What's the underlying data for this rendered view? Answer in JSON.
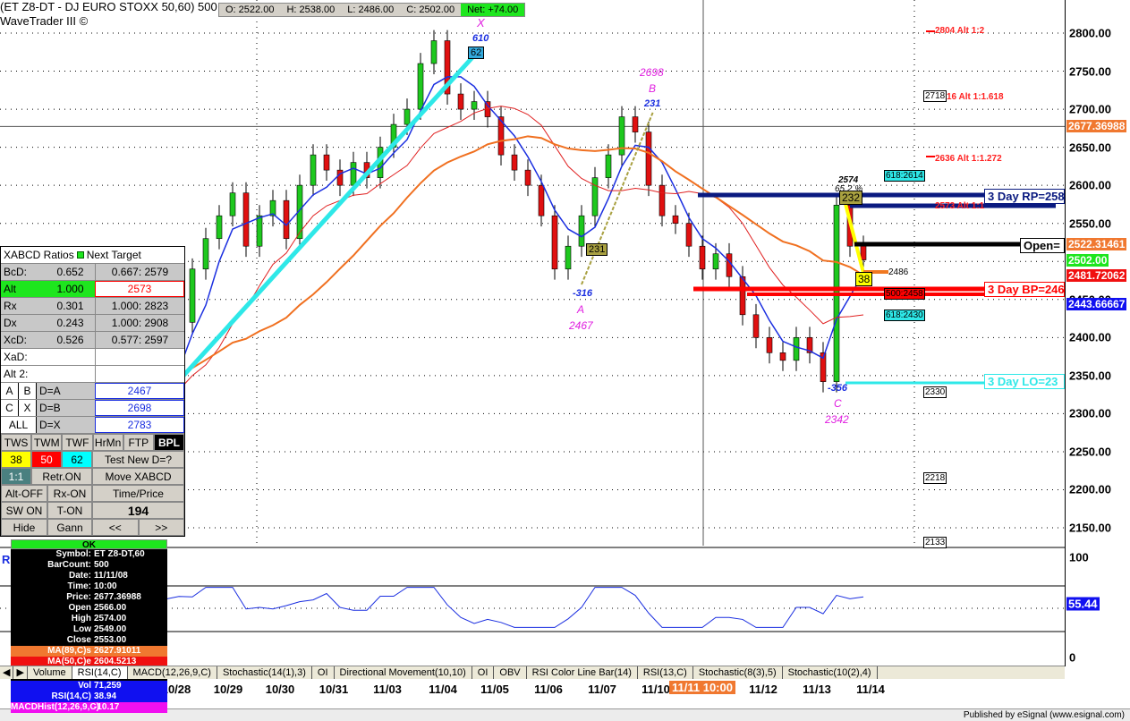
{
  "header": {
    "title": "(ET Z8-DT - DJ EURO STOXX 50,60) 500 Bars,0:00",
    "subtitle": "WaveTrader III ©"
  },
  "ohlc": {
    "open": "O: 2522.00",
    "high": "H: 2538.00",
    "low": "L: 2486.00",
    "close": "C: 2502.00",
    "net": "Net: +74.00"
  },
  "price_axis": {
    "ticks": [
      "2800.00",
      "2750.00",
      "2700.00",
      "2650.00",
      "2600.00",
      "2550.00",
      "2450.00",
      "2400.00",
      "2350.00",
      "2300.00",
      "2250.00",
      "2200.00",
      "2150.00"
    ],
    "badges": [
      {
        "text": "2677.36988",
        "color": "#f07830"
      },
      {
        "text": "2522.31461",
        "color": "#f07830"
      },
      {
        "text": "2502.00",
        "color": "#1ee61e"
      },
      {
        "text": "2481.72062",
        "color": "#f01010"
      },
      {
        "text": "2443.66667",
        "color": "#1010f0"
      }
    ]
  },
  "rsi_axis": {
    "ticks": [
      "100",
      "0"
    ],
    "value": "55.44"
  },
  "chart_data": {
    "type": "candlestick",
    "closes": [
      2430,
      2380,
      2440,
      2350,
      2300,
      2390,
      2330,
      2280,
      2320,
      2260,
      2300,
      2380,
      2330,
      2420,
      2490,
      2530,
      2560,
      2590,
      2520,
      2560,
      2580,
      2530,
      2600,
      2640,
      2620,
      2600,
      2630,
      2610,
      2650,
      2680,
      2700,
      2760,
      2790,
      2720,
      2700,
      2710,
      2690,
      2640,
      2620,
      2600,
      2560,
      2490,
      2520,
      2560,
      2610,
      2640,
      2690,
      2670,
      2600,
      2560,
      2550,
      2520,
      2490,
      2510,
      2480,
      2430,
      2400,
      2380,
      2370,
      2400,
      2380,
      2342,
      2574,
      2520,
      2502
    ],
    "ylim": [
      2130,
      2830
    ],
    "ma_colors": [
      "#1a2ee0",
      "#e02020",
      "#f07020"
    ]
  },
  "annotations": {
    "x_label": "X",
    "x_val": "610",
    "x_box": "62",
    "b_price": "2698",
    "b_label": "B",
    "b_val": "231",
    "a_box": "231",
    "a_val": "-316",
    "a_label": "A",
    "a_price": "2467",
    "c_val": "-356",
    "c_label": "C",
    "c_price": "2342",
    "d_price": "2574",
    "d_pct": "65.2 %",
    "d_box": "232",
    "d38": "38",
    "d2486": "2486"
  },
  "levels": {
    "alt12": "2804 Alt 1:2",
    "alt1618": "16 Alt 1:1.618",
    "box2718": "2718",
    "alt1272": "2636 Alt 1:1.272",
    "f618a": "618:2614",
    "rp": "3 Day RP=258",
    "alt11": "2573 Alt 1:1",
    "open": "Open=",
    "bp": "3 Day BP=246",
    "f500": "500:2458",
    "f618b": "618:2430",
    "lo": "3 Day LO=23",
    "box2330": "2330",
    "box2218": "2218",
    "box2133": "2133"
  },
  "panel": {
    "head": "XABCD Ratios",
    "head2": "Next Target",
    "rows": [
      [
        "BcD:",
        "0.652",
        "0.667: 2579"
      ],
      [
        "Alt",
        "1.000",
        "2573"
      ],
      [
        "Rx",
        "0.301",
        "1.000: 2823"
      ],
      [
        "Dx",
        "0.243",
        "1.000: 2908"
      ],
      [
        "XcD:",
        "0.526",
        "0.577: 2597"
      ],
      [
        "XaD:",
        "",
        ""
      ],
      [
        "Alt 2:",
        "",
        ""
      ]
    ],
    "drows": [
      [
        "A",
        "B",
        "D=A",
        "2467"
      ],
      [
        "C",
        "X",
        "D=B",
        "2698"
      ],
      [
        "ALL",
        "",
        "D=X",
        "2783"
      ]
    ],
    "b1": [
      "TWS",
      "TWM",
      "TWF",
      "HrMn",
      "FTP",
      "BPL"
    ],
    "fib": [
      "38",
      "50",
      "62"
    ],
    "test": "Test New D=?",
    "r3": [
      "1:1",
      "Retr.ON",
      "Move XABCD"
    ],
    "r4": [
      "Alt-OFF",
      "Rx-ON",
      "Time/Price"
    ],
    "r5": [
      "SW ON",
      "T-ON",
      "194"
    ],
    "r6": [
      "Hide",
      "Gann",
      "<<",
      ">>"
    ]
  },
  "data_window": {
    "ok": "OK",
    "rows": [
      [
        "Symbol:",
        "ET Z8-DT,60"
      ],
      [
        "BarCount:",
        "500"
      ],
      [
        "Date:",
        "11/11/08"
      ],
      [
        "Time:",
        "10:00"
      ],
      [
        "Price:",
        "2677.36988"
      ],
      [
        "Open",
        "2566.00"
      ],
      [
        "High",
        "2574.00"
      ],
      [
        "Low",
        "2549.00"
      ],
      [
        "Close",
        "2553.00"
      ]
    ],
    "ma89": [
      "MA(89,C)s",
      "2627.91011"
    ],
    "ma50": [
      "MA(50,C)e",
      "2604.5213"
    ],
    "vol": [
      "Vol",
      "71,259"
    ],
    "rsi": [
      "RSI(14,C)",
      "38.94"
    ],
    "macd": [
      "MACDHist(12,26,9,C)",
      "-10.17"
    ]
  },
  "tabs": [
    "Volume",
    "RSI(14,C)",
    "MACD(12,26,9,C)",
    "Stochastic(14(1),3)",
    "OI",
    "Directional Movement(10,10)",
    "OI",
    "OBV",
    "RSI Color Line Bar(14)",
    "RSI(13,C)",
    "Stochastic(8(3),5)",
    "Stochastic(10(2),4)"
  ],
  "dates": [
    "10/28",
    "10/29",
    "10/30",
    "10/31",
    "11/03",
    "11/04",
    "11/05",
    "11/06",
    "11/07",
    "11/10",
    "11/11 10:00",
    "11/12",
    "11/13",
    "11/14"
  ],
  "footer": "Published by eSignal (www.esignal.com)"
}
